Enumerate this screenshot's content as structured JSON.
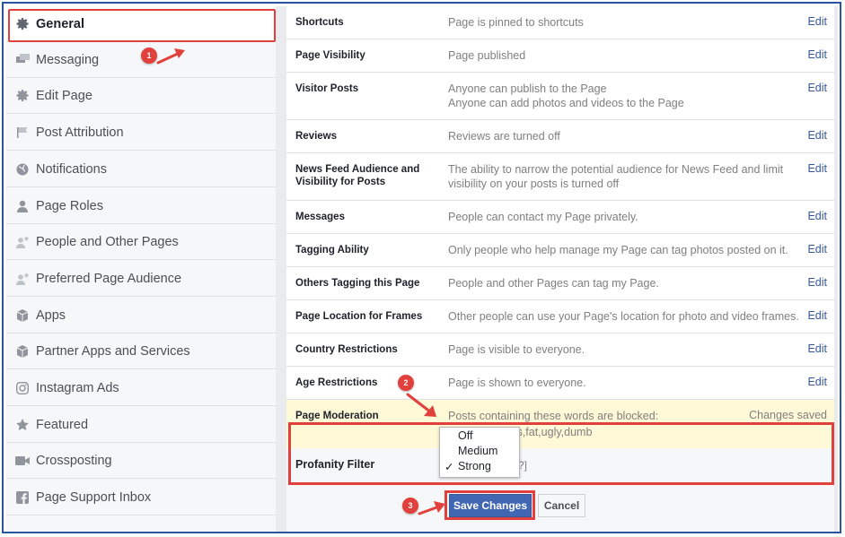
{
  "sidebar": {
    "items": [
      {
        "label": "General",
        "icon": "gear-icon",
        "active": true
      },
      {
        "label": "Messaging",
        "icon": "messages-icon"
      },
      {
        "label": "Edit Page",
        "icon": "gear-icon"
      },
      {
        "label": "Post Attribution",
        "icon": "flag-icon"
      },
      {
        "label": "Notifications",
        "icon": "globe-icon"
      },
      {
        "label": "Page Roles",
        "icon": "person-icon"
      },
      {
        "label": "People and Other Pages",
        "icon": "person-star-icon"
      },
      {
        "label": "Preferred Page Audience",
        "icon": "person-star-icon"
      },
      {
        "label": "Apps",
        "icon": "cube-icon"
      },
      {
        "label": "Partner Apps and Services",
        "icon": "cube-icon"
      },
      {
        "label": "Instagram Ads",
        "icon": "instagram-icon"
      },
      {
        "label": "Featured",
        "icon": "star-icon"
      },
      {
        "label": "Crossposting",
        "icon": "video-camera-icon"
      },
      {
        "label": "Page Support Inbox",
        "icon": "facebook-icon"
      }
    ]
  },
  "settings": {
    "edit_label": "Edit",
    "rows": [
      {
        "key": "Shortcuts",
        "value": "Page is pinned to shortcuts"
      },
      {
        "key": "Page Visibility",
        "value": "Page published"
      },
      {
        "key": "Visitor Posts",
        "value": "Anyone can publish to the Page",
        "value2": "Anyone can add photos and videos to the Page"
      },
      {
        "key": "Reviews",
        "value": "Reviews are turned off"
      },
      {
        "key": "News Feed Audience and",
        "key2": "Visibility for Posts",
        "value": "The ability to narrow the potential audience for News Feed and limit",
        "value2": "visibility on your posts is turned off"
      },
      {
        "key": "Messages",
        "value": "People can contact my Page privately."
      },
      {
        "key": "Tagging Ability",
        "value": "Only people who help manage my Page can tag photos posted on it."
      },
      {
        "key": "Others Tagging this Page",
        "value": "People and other Pages can tag my Page."
      },
      {
        "key": "Page Location for Frames",
        "value": "Other people can use your Page's location for photo and video frames."
      },
      {
        "key": "Country Restrictions",
        "value": "Page is visible to everyone."
      },
      {
        "key": "Age Restrictions",
        "value": "Page is shown to everyone."
      }
    ],
    "moderation": {
      "key": "Page Moderation",
      "value": "Posts containing these words are blocked:",
      "status": "Changes saved",
      "words": "rthless,fat,ugly,dumb"
    },
    "profanity": {
      "key": "Profanity Filter",
      "options": [
        "Off",
        "Medium",
        "Strong"
      ],
      "selected": "Strong",
      "check": "✓",
      "bracket": "?]"
    }
  },
  "buttons": {
    "save": "Save Changes",
    "cancel": "Cancel"
  },
  "annotations": {
    "badge1": "1",
    "badge2": "2",
    "badge3": "3"
  },
  "colors": {
    "highlight": "#e2403c",
    "link": "#365899",
    "primary_button": "#4267b2",
    "moderation_bg": "#fff9d7"
  }
}
